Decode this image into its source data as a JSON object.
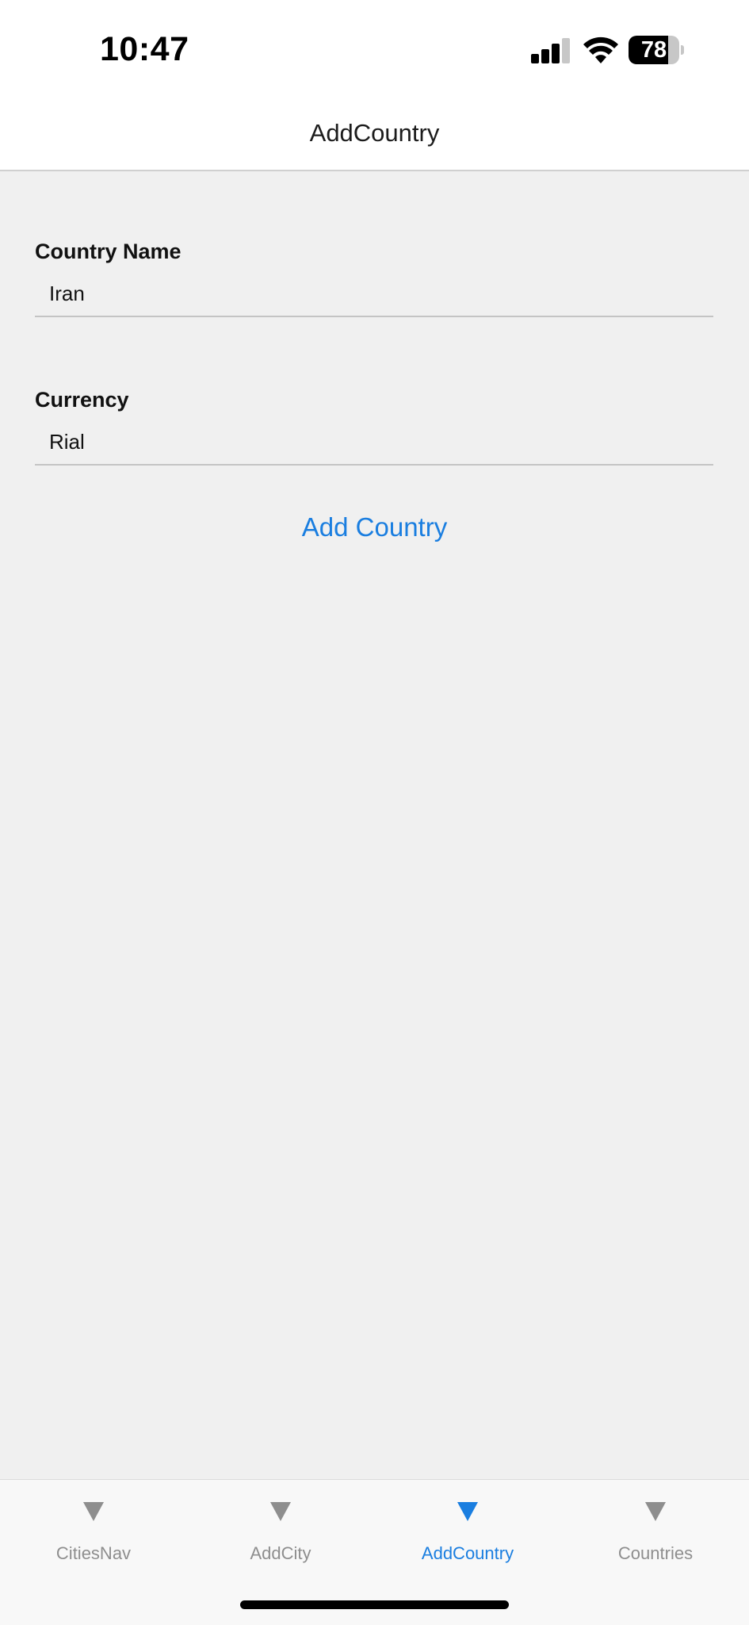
{
  "status_bar": {
    "time": "10:47",
    "battery_level": "78",
    "battery_fraction": 0.78,
    "icons": [
      "signal-icon",
      "wifi-icon",
      "battery-icon"
    ]
  },
  "nav": {
    "title": "AddCountry"
  },
  "form": {
    "country_name": {
      "label": "Country Name",
      "value": "Iran"
    },
    "currency": {
      "label": "Currency",
      "value": "Rial"
    },
    "submit_label": "Add Country"
  },
  "tabs": [
    {
      "label": "CitiesNav",
      "icon": "triangle-down-icon",
      "active": false
    },
    {
      "label": "AddCity",
      "icon": "triangle-down-icon",
      "active": false
    },
    {
      "label": "AddCountry",
      "icon": "triangle-down-icon",
      "active": true
    },
    {
      "label": "Countries",
      "icon": "triangle-down-icon",
      "active": false
    }
  ],
  "colors": {
    "accent": "#1a7ee0",
    "background": "#f0f0f0",
    "inactive_tab": "#8e8e8e"
  }
}
